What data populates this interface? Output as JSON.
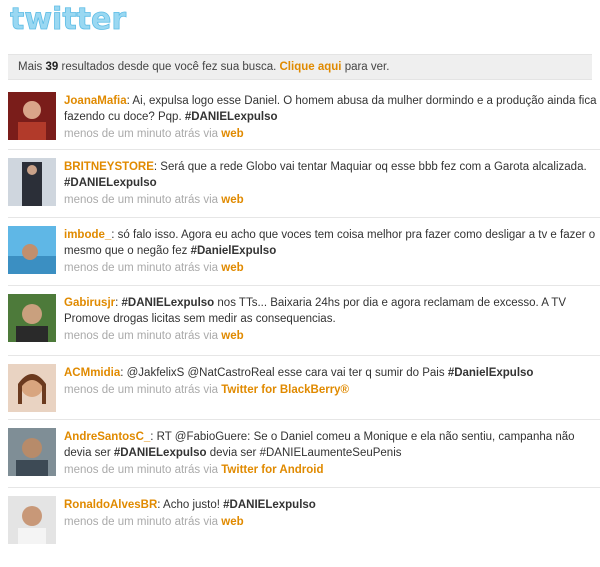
{
  "brand": {
    "logo_text": "twitter"
  },
  "notice": {
    "prefix": "Mais",
    "count": "39",
    "middle": "resultados desde que você fez sua busca.",
    "link": "Clique aqui",
    "suffix": "para ver."
  },
  "tweets": [
    {
      "user": "JoanaMafia",
      "before": ": Ai, expulsa logo esse Daniel. O homem abusa da mulher dormindo e a produção ainda fica fazendo cu doce? Pqp. ",
      "tag": "#DANIELexpulso",
      "after": "",
      "time": "menos de um minuto atrás",
      "via": "via",
      "source": "web"
    },
    {
      "user": "BRITNEYSTORE",
      "before": ": Será que a rede Globo vai tentar Maquiar oq esse bbb fez com a Garota alcalizada. ",
      "tag": "#DANIELexpulso",
      "after": "",
      "time": "menos de um minuto atrás",
      "via": "via",
      "source": "web"
    },
    {
      "user": "imbode_",
      "before": ": só falo isso. Agora eu acho que voces tem coisa melhor pra fazer como desligar a tv e fazer o mesmo que o negão fez ",
      "tag": "#DanielExpulso",
      "after": "",
      "time": "menos de um minuto atrás",
      "via": "via",
      "source": "web"
    },
    {
      "user": "Gabirusjr",
      "before": ": ",
      "tag": "#DANIELexpulso",
      "after": " nos TTs... Baixaria 24hs por dia e agora reclamam de excesso. A TV Promove drogas licitas sem medir as consequencias.",
      "time": "menos de um minuto atrás",
      "via": "via",
      "source": "web"
    },
    {
      "user": "ACMmidia",
      "before": ": @JakfelixS @NatCastroReal esse cara vai ter q sumir do Pais ",
      "tag": "#DanielExpulso",
      "after": "",
      "time": "menos de um minuto atrás",
      "via": "via",
      "source": "Twitter for BlackBerry®"
    },
    {
      "user": "AndreSantosC_",
      "before": ": RT @FabioGuere: Se o Daniel comeu a Monique e ela não sentiu, campanha não devia ser ",
      "tag": "#DANIELexpulso",
      "after": " devia ser #DANIELaumenteSeuPenis",
      "time": "menos de um minuto atrás",
      "via": "via",
      "source": "Twitter for Android"
    },
    {
      "user": "RonaldoAlvesBR",
      "before": ": Acho justo! ",
      "tag": "#DANIELexpulso",
      "after": "",
      "time": "menos de um minuto atrás",
      "via": "via",
      "source": "web"
    }
  ],
  "colors": {
    "accent": "#e08a00",
    "logo": "#8fd3f0",
    "notice_bg": "#efefef",
    "meta": "#aaaaaa"
  }
}
